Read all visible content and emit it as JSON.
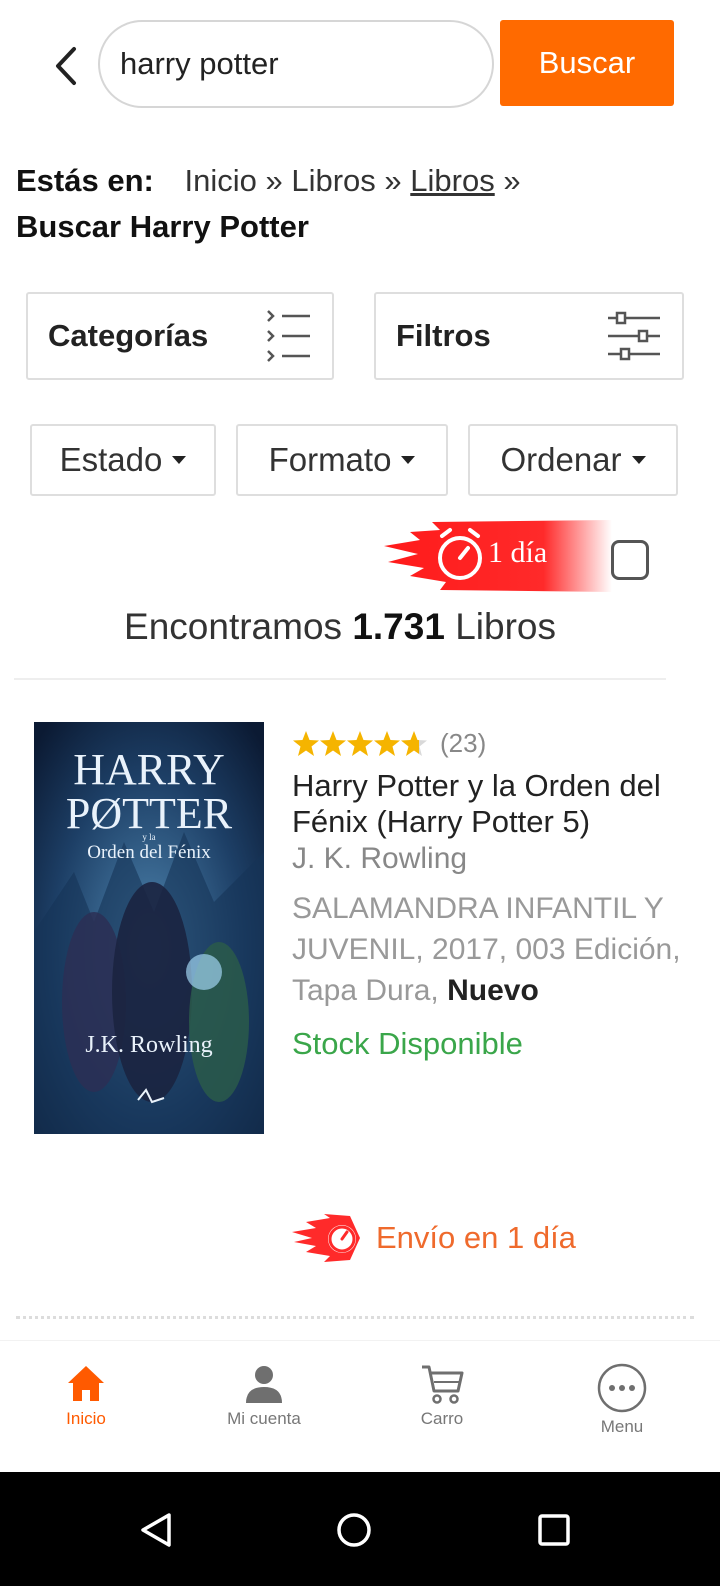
{
  "search": {
    "query": "harry potter",
    "button_label": "Buscar"
  },
  "breadcrumb": {
    "prefix": "Estás en:",
    "items": [
      "Inicio",
      "»",
      "Libros",
      "»",
      "Libros",
      "»"
    ],
    "current": "Buscar Harry Potter"
  },
  "filters": {
    "categories_label": "Categorías",
    "filters_label": "Filtros",
    "dropdowns": [
      {
        "label": "Estado"
      },
      {
        "label": "Formato"
      },
      {
        "label": "Ordenar"
      }
    ],
    "fast_delivery_label": "1 día"
  },
  "results": {
    "prefix": "Encontramos",
    "count": "1.731",
    "suffix": "Libros"
  },
  "product": {
    "rating": 4.7,
    "reviews": "(23)",
    "title": "Harry Potter y la Orden del Fénix (Harry Potter 5)",
    "author": "J. K. Rowling",
    "details": "SALAMANDRA INFANTIL Y JUVENIL, 2017, 003 Edición, Tapa Dura,",
    "condition": "Nuevo",
    "stock": "Stock Disponible",
    "shipping": "Envío en 1 día",
    "cover": {
      "title_line1": "HARRY",
      "title_line2": "PØTTER",
      "title_small": "y la",
      "subtitle": "Orden del Fénix",
      "author": "J.K. Rowling"
    }
  },
  "bottom_nav": {
    "items": [
      {
        "label": "Inicio",
        "icon": "home-icon",
        "active": true
      },
      {
        "label": "Mi cuenta",
        "icon": "user-icon",
        "active": false
      },
      {
        "label": "Carro",
        "icon": "cart-icon",
        "active": false
      },
      {
        "label": "Menu",
        "icon": "more-icon",
        "active": false
      }
    ]
  },
  "colors": {
    "accent": "#ff6a00",
    "stock_green": "#3aa64a",
    "shipping_orange": "#ef6a2c",
    "star": "#f5b400"
  }
}
